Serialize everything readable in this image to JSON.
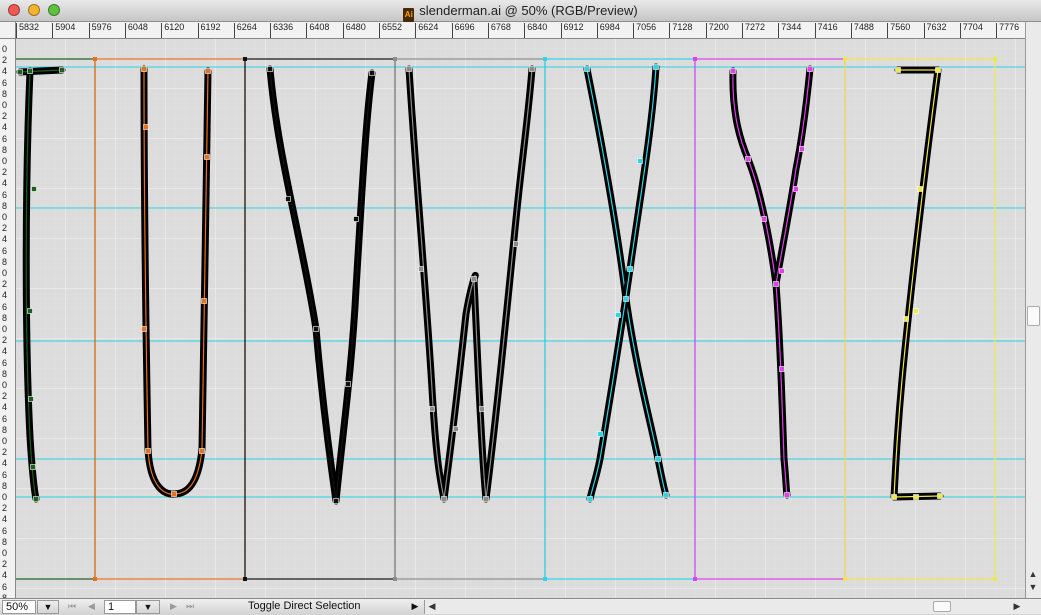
{
  "window": {
    "title": "slenderman.ai @ 50% (RGB/Preview)",
    "file_icon_label": "Ai",
    "traffic_lights": [
      "#ee5a52",
      "#f5b32f",
      "#5fc13f"
    ]
  },
  "ruler": {
    "h_ticks": [
      "5832",
      "5904",
      "5976",
      "6048",
      "6120",
      "6192",
      "6264",
      "6336",
      "6408",
      "6480",
      "6552",
      "6624",
      "6696",
      "6768",
      "6840",
      "6912",
      "6984",
      "7056",
      "7128",
      "7200",
      "7272",
      "7344",
      "7416",
      "7488",
      "7560",
      "7632",
      "7704",
      "7776"
    ],
    "v_labels": [
      "0",
      "2",
      "4",
      "6",
      "8",
      "0",
      "2",
      "4",
      "6",
      "8",
      "0",
      "2",
      "4",
      "6",
      "8",
      "0",
      "2",
      "4",
      "6",
      "8",
      "0",
      "2",
      "4",
      "6",
      "8",
      "0",
      "2",
      "4",
      "6",
      "8",
      "0",
      "2",
      "4",
      "6",
      "8",
      "0",
      "2",
      "4",
      "6",
      "8",
      "0",
      "2",
      "4",
      "6",
      "8",
      "0",
      "2",
      "4",
      "6",
      "8"
    ]
  },
  "colors": {
    "guide": "#27d3e6",
    "grid_minor": "#e2e2e2",
    "grid_major": "#f4f4f4",
    "canvas_bg": "#dcdcdc"
  },
  "glyphs": [
    {
      "letter": "T",
      "color": "#1b5e20"
    },
    {
      "letter": "U",
      "color": "#e8711a"
    },
    {
      "letter": "V",
      "color": "#111111"
    },
    {
      "letter": "W",
      "color": "#8c8c8c"
    },
    {
      "letter": "X",
      "color": "#2ad6e8"
    },
    {
      "letter": "Y",
      "color": "#e040ea"
    },
    {
      "letter": "Z",
      "color": "#efe84a"
    }
  ],
  "statusbar": {
    "zoom": "50%",
    "page": "1",
    "status_text": "Toggle Direct Selection",
    "nav_first": "⏮",
    "nav_prev": "◀",
    "nav_next": "▶",
    "nav_last": "⏭",
    "dropdown_glyph": "▼",
    "status_arrow": "▶"
  }
}
